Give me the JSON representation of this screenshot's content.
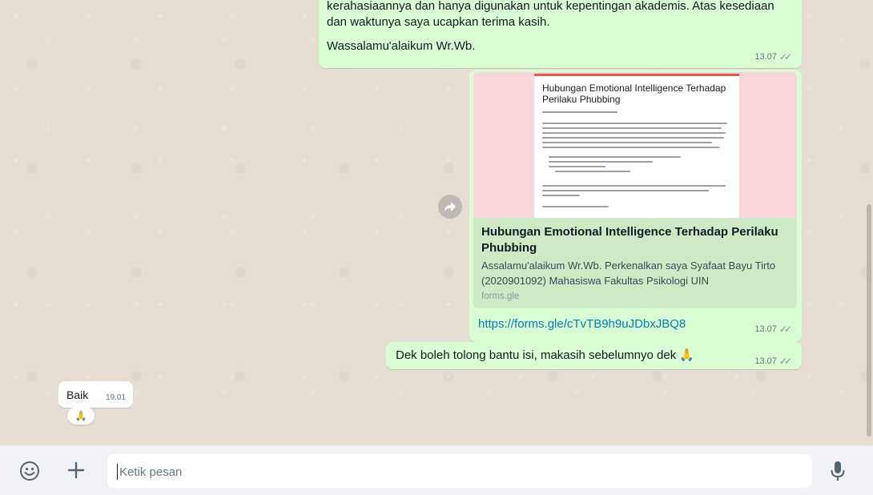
{
  "messages": {
    "m1": {
      "text_top": "kerahasiaannya dan hanya digunakan untuk kepentingan akademis. Atas kesediaan dan waktunya saya ucapkan terima kasih.",
      "text_bottom": "Wassalamu'alaikum Wr.Wb.",
      "time": "13.07",
      "ticks": "✓✓"
    },
    "m2": {
      "preview_image_title": "Hubungan Emotional Intelligence Terhadap Perilaku Phubbing",
      "preview_title": "Hubungan Emotional Intelligence Terhadap Perilaku Phubbing",
      "preview_description": "Assalamu'alaikum Wr.Wb. Perkenalkan saya Syafaat Bayu Tirto (2020901092) Mahasiswa Fakultas Psikologi UIN",
      "preview_domain": "forms.gle",
      "link": "https://forms.gle/cTvTB9h9uJDbxJBQ8",
      "time": "13.07",
      "ticks": "✓✓"
    },
    "m3": {
      "text": "Dek boleh tolong bantu isi, makasih sebelumnyo dek",
      "emoji": "🙏",
      "time": "13.07",
      "ticks": "✓✓"
    },
    "m4": {
      "text": "Baik",
      "time": "19.01",
      "reaction": "🙏"
    }
  },
  "composer": {
    "placeholder": "Ketik pesan",
    "emoji_icon": "emoji-icon",
    "attach_icon": "plus-icon",
    "mic_icon": "microphone-icon"
  },
  "colors": {
    "outgoing_bubble": "#d9fdd3",
    "incoming_bubble": "#ffffff",
    "link": "#027eb5",
    "form_accent": "#e25b45"
  }
}
